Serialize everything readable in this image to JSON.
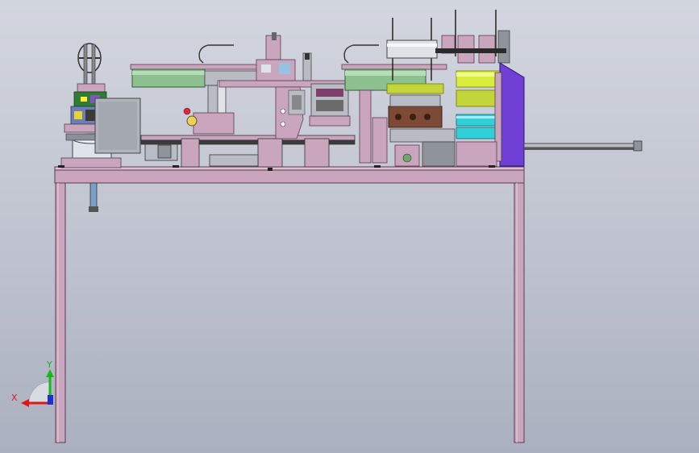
{
  "view": {
    "background_top": "#d3d6df",
    "background_bottom": "#aab0bf"
  },
  "colors": {
    "frame": "#c9a6bd",
    "frame_edge": "#5a3b50",
    "roller_green": "#8dc08f",
    "roller_yellow": "#d8ee3a",
    "roller_cyan": "#2fd0d8",
    "panel_purple": "#6f3fd6",
    "brown_block": "#7c4a35",
    "steel": "#b9bcc4",
    "dark": "#2a2a2a"
  },
  "triad": {
    "x_label": "X",
    "y_label": "Y",
    "x_color": "#e01818",
    "y_color": "#18b818",
    "z_color": "#1c2fd0"
  }
}
